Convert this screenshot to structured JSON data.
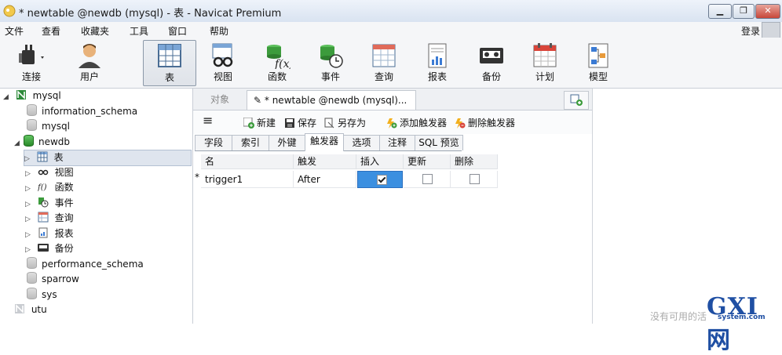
{
  "window": {
    "title": "* newtable @newdb (mysql) - 表 - Navicat Premium",
    "min_label": "▁",
    "max_label": "❐",
    "close_label": "✕"
  },
  "menu": {
    "items": [
      "文件",
      "查看",
      "收藏夹",
      "工具",
      "窗口",
      "帮助"
    ],
    "login": "登录"
  },
  "toolbar": {
    "items": [
      "连接",
      "用户",
      "表",
      "视图",
      "函数",
      "事件",
      "查询",
      "报表",
      "备份",
      "计划",
      "模型"
    ],
    "active": "表"
  },
  "tree": {
    "connection": "mysql",
    "databases": [
      "information_schema",
      "mysql",
      "newdb"
    ],
    "newdb_children": [
      "表",
      "视图",
      "函数",
      "事件",
      "查询",
      "报表",
      "备份"
    ],
    "more_databases": [
      "performance_schema",
      "sparrow",
      "sys"
    ],
    "connection2": "utu"
  },
  "editor": {
    "tabs": {
      "objects": "对象",
      "current": "* newtable @newdb (mysql)..."
    },
    "actions": {
      "menu": "≡",
      "new": "新建",
      "save": "保存",
      "save_as": "另存为",
      "add_trigger": "添加触发器",
      "delete_trigger": "删除触发器"
    },
    "subtabs": [
      "字段",
      "索引",
      "外键",
      "触发器",
      "选项",
      "注释",
      "SQL 预览"
    ],
    "active_subtab": "触发器",
    "grid": {
      "columns": [
        "名",
        "触发",
        "插入",
        "更新",
        "删除"
      ],
      "rows": [
        {
          "marker": "*",
          "name": "trigger1",
          "fires": "After",
          "insert": true,
          "update": false,
          "delete": false
        }
      ]
    }
  },
  "watermark": {
    "text": "没有可用的活",
    "logo_big": "GXI网",
    "logo_small": "system.com"
  },
  "colors": {
    "accent": "#3b8fe0",
    "selected_tree": "#dfe5ee"
  }
}
